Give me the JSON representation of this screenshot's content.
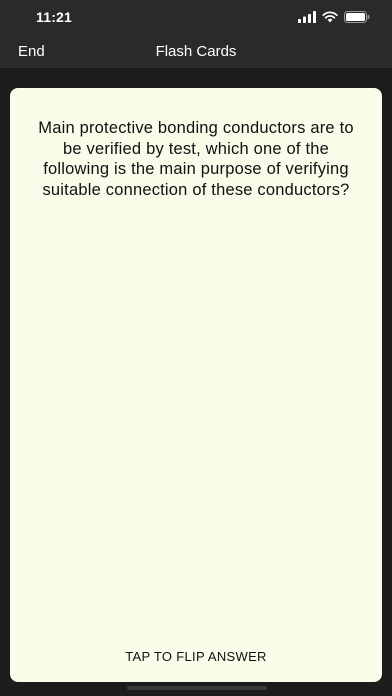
{
  "status_bar": {
    "time": "11:21",
    "icons": [
      "cellular-signal-icon",
      "wifi-icon",
      "battery-icon"
    ]
  },
  "nav": {
    "left_button": "End",
    "title": "Flash Cards"
  },
  "card": {
    "question": "Main protective bonding conductors are to be verified by test, which one of the following is the main purpose of verifying suitable connection of these conductors?",
    "hint": "TAP TO FLIP ANSWER"
  },
  "colors": {
    "background": "#1f1f1f",
    "bar": "#2a2a2a",
    "card": "#fbfbea",
    "text_on_card": "#111111"
  }
}
